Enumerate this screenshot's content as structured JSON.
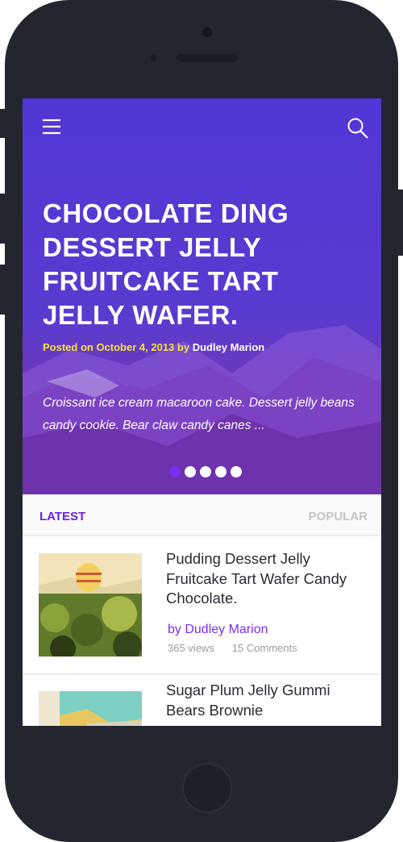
{
  "hero": {
    "title": "CHOCOLATE DING DESSERT JELLY FRUITCAKE TART JELLY WAFER.",
    "meta_prefix": "Posted on October 4, 2013 by",
    "meta_author": "Dudley Marion",
    "excerpt": "Croissant ice cream macaroon cake. Dessert jelly beans candy cookie. Bear claw candy canes ...",
    "slide_count": 5,
    "active_slide": 1
  },
  "tabs": {
    "latest": "LATEST",
    "popular": "POPULAR"
  },
  "posts": [
    {
      "title": "Pudding Dessert Jelly Fruitcake Tart Wafer Candy Chocolate.",
      "author": "by Dudley Marion",
      "views": "365 views",
      "comments": "15 Comments"
    },
    {
      "title": "Sugar Plum Jelly Gummi Bears Brownie"
    }
  ],
  "colors": {
    "accent": "#6a1fe6",
    "hero": "#5236d6",
    "meta": "#f5e33a"
  }
}
